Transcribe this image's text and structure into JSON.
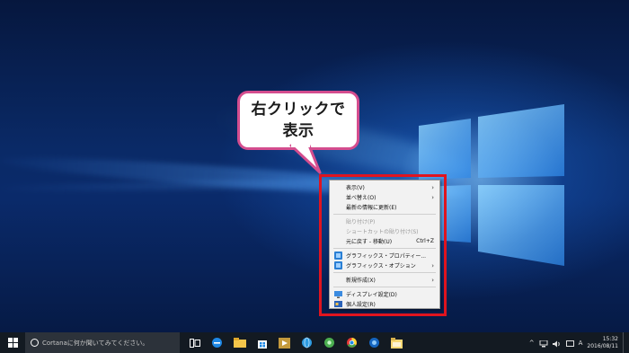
{
  "callout": {
    "line1": "右クリックで",
    "line2": "表示"
  },
  "context_menu": {
    "items": [
      {
        "label": "表示(V)",
        "submenu": true,
        "disabled": false,
        "shortcut": "",
        "icon": ""
      },
      {
        "label": "並べ替え(O)",
        "submenu": true,
        "disabled": false,
        "shortcut": "",
        "icon": ""
      },
      {
        "label": "最新の情報に更新(E)",
        "submenu": false,
        "disabled": false,
        "shortcut": "",
        "icon": ""
      },
      {
        "separator": true
      },
      {
        "label": "貼り付け(P)",
        "submenu": false,
        "disabled": true,
        "shortcut": "",
        "icon": ""
      },
      {
        "label": "ショートカットの貼り付け(S)",
        "submenu": false,
        "disabled": true,
        "shortcut": "",
        "icon": ""
      },
      {
        "label": "元に戻す - 移動(U)",
        "submenu": false,
        "disabled": false,
        "shortcut": "Ctrl+Z",
        "icon": ""
      },
      {
        "separator": true
      },
      {
        "label": "グラフィックス・プロパティー...",
        "submenu": false,
        "disabled": false,
        "shortcut": "",
        "icon": "graphics-properties-icon"
      },
      {
        "label": "グラフィックス・オプション",
        "submenu": true,
        "disabled": false,
        "shortcut": "",
        "icon": "graphics-options-icon"
      },
      {
        "separator": true
      },
      {
        "label": "新規作成(X)",
        "submenu": true,
        "disabled": false,
        "shortcut": "",
        "icon": ""
      },
      {
        "separator": true
      },
      {
        "label": "ディスプレイ設定(D)",
        "submenu": false,
        "disabled": false,
        "shortcut": "",
        "icon": "display-settings-icon"
      },
      {
        "label": "個人設定(R)",
        "submenu": false,
        "disabled": false,
        "shortcut": "",
        "icon": "personalize-icon"
      }
    ]
  },
  "taskbar": {
    "search_placeholder": "Cortanaに何か聞いてみてください。",
    "apps": [
      "task-view-icon",
      "edge-icon",
      "file-explorer-icon",
      "store-icon",
      "media-icon",
      "globe-icon",
      "green-app-icon",
      "chrome-icon",
      "edge-alt-icon",
      "folder-icon"
    ],
    "ime": "A",
    "time": "15:32",
    "date": "2016/08/11"
  },
  "colors": {
    "callout_border": "#d44d8e",
    "highlight_border": "#e0141f",
    "taskbar_bg": "#131a22",
    "menu_bg": "#f2f2f2"
  }
}
